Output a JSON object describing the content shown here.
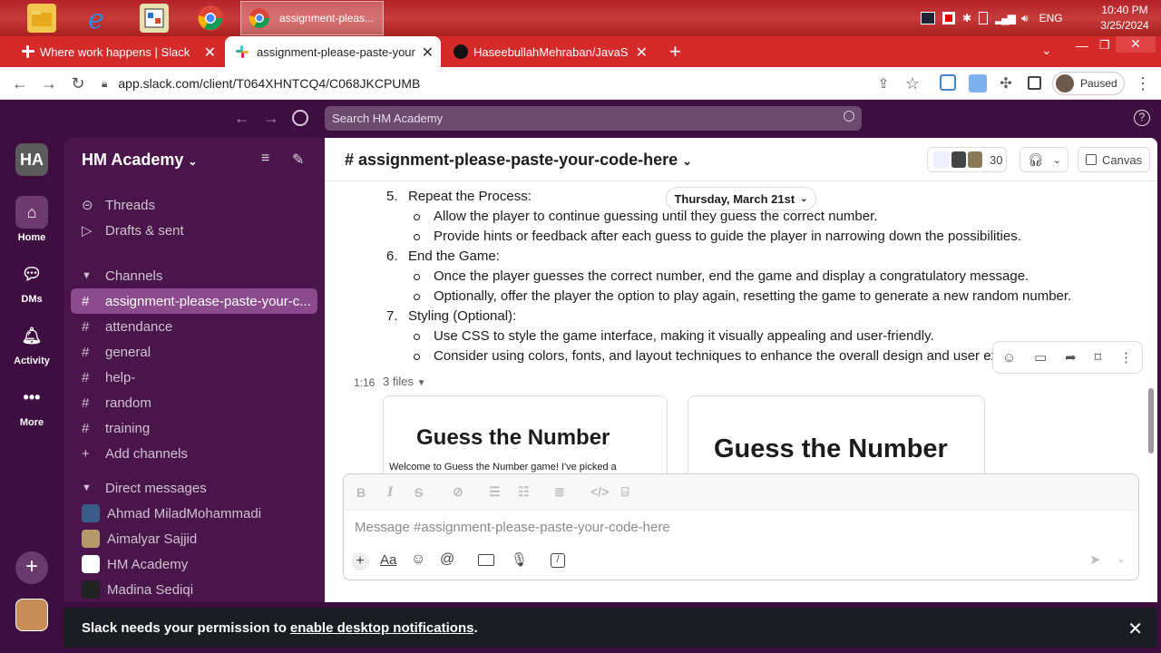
{
  "taskbar": {
    "active_window_label": "assignment-pleas...",
    "language": "ENG",
    "time": "10:40 PM",
    "date": "3/25/2024"
  },
  "browser": {
    "tabs": [
      {
        "label": "Where work happens | Slack"
      },
      {
        "label": "assignment-please-paste-your-cc"
      },
      {
        "label": "HaseebullahMehraban/JavaScrip"
      }
    ],
    "url": "app.slack.com/client/T064XHNTCQ4/C068JKCPUMB",
    "profile_status": "Paused"
  },
  "slack": {
    "search_placeholder": "Search HM Academy",
    "workspace_initials": "HA",
    "workspace_name": "HM Academy",
    "rail": [
      {
        "label": "Home"
      },
      {
        "label": "DMs"
      },
      {
        "label": "Activity"
      },
      {
        "label": "More"
      }
    ],
    "sidebar": {
      "threads": "Threads",
      "drafts": "Drafts & sent",
      "channels_header": "Channels",
      "channels": [
        {
          "name": "assignment-please-paste-your-c..."
        },
        {
          "name": "attendance"
        },
        {
          "name": "general"
        },
        {
          "name": "help-"
        },
        {
          "name": "random"
        },
        {
          "name": "training"
        }
      ],
      "add_channels": "Add channels",
      "dm_header": "Direct messages",
      "dms": [
        {
          "name": "Ahmad MiladMohammadi"
        },
        {
          "name": "Aimalyar Sajjid"
        },
        {
          "name": "HM Academy"
        },
        {
          "name": "Madina Sediqi"
        }
      ]
    },
    "channel": {
      "title": "# assignment-please-paste-your-code-here",
      "member_count": "30",
      "canvas_label": "Canvas",
      "date_divider": "Thursday, March 21st"
    },
    "message": {
      "items": [
        {
          "num": "5.",
          "heading": "Repeat the Process:"
        },
        {
          "bullet": "Allow the player to continue guessing until they guess the correct number."
        },
        {
          "bullet": "Provide hints or feedback after each guess to guide the player in narrowing down the possibilities."
        },
        {
          "num": "6.",
          "heading": "End the Game:"
        },
        {
          "bullet": "Once the player guesses the correct number, end the game and display a congratulatory message."
        },
        {
          "bullet": "Optionally, offer the player the option to play again, resetting the game to generate a new random number."
        },
        {
          "num": "7.",
          "heading": "Styling (Optional):"
        },
        {
          "bullet": "Use CSS to style the game interface, making it visually appealing and user-friendly."
        },
        {
          "bullet": "Consider using colors, fonts, and layout techniques to enhance the overall design and user exp"
        }
      ],
      "timestamp": "1:16",
      "files_label": "3 files",
      "file1_title": "Guess the Number",
      "file1_sub": "Welcome to Guess the Number game! I've picked a",
      "file2_title": "Guess the Number"
    },
    "composer_placeholder": "Message #assignment-please-paste-your-code-here",
    "banner": {
      "text": "Slack needs your permission to ",
      "link": "enable desktop notifications",
      "end": "."
    }
  }
}
